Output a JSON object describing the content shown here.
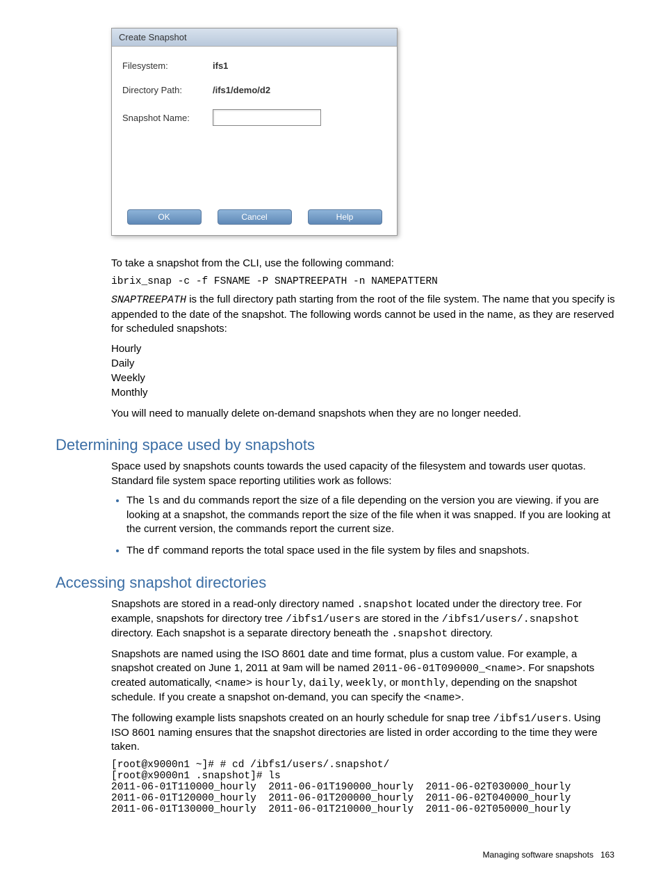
{
  "dialog": {
    "title": "Create Snapshot",
    "filesystem_label": "Filesystem:",
    "filesystem_value": "ifs1",
    "dirpath_label": "Directory Path:",
    "dirpath_value": "/ifs1/demo/d2",
    "snapname_label": "Snapshot Name:",
    "ok_label": "OK",
    "cancel_label": "Cancel",
    "help_label": "Help"
  },
  "body": {
    "cli_intro": "To take a snapshot from the CLI, use the following command:",
    "cli_cmd": "ibrix_snap -c -f FSNAME -P SNAPTREEPATH -n NAMEPATTERN",
    "snaptreepath_code": "SNAPTREEPATH",
    "snaptreepath_desc": " is the full directory path starting from the root of the file system. The name that you specify is appended to the date of the snapshot. The following words cannot be used in the name, as they are reserved for scheduled snapshots:",
    "reserved1": "Hourly",
    "reserved2": "Daily",
    "reserved3": "Weekly",
    "reserved4": "Monthly",
    "manual_delete": "You will need to manually delete on-demand snapshots when they are no longer needed."
  },
  "section1": {
    "heading": "Determining space used by snapshots",
    "para": "Space used by snapshots counts towards the used capacity of the filesystem and towards user quotas. Standard file system space reporting utilities work as follows:",
    "bullet1_a": "The ",
    "bullet1_ls": "ls",
    "bullet1_b": " and ",
    "bullet1_du": "du",
    "bullet1_c": " commands report the size of a file depending on the version you are viewing. if you are looking at a snapshot, the commands report the size of the file when it was snapped. If you are looking at the current version, the commands report the current size.",
    "bullet2_a": "The ",
    "bullet2_df": "df",
    "bullet2_b": " command reports the total space used in the file system by files and snapshots."
  },
  "section2": {
    "heading": "Accessing snapshot directories",
    "p1_a": "Snapshots are stored in a read-only directory named ",
    "p1_snap": ".snapshot",
    "p1_b": " located under the directory tree. For example, snapshots for directory tree ",
    "p1_path1": "/ibfs1/users",
    "p1_c": " are stored in the ",
    "p1_path2": "/ibfs1/users/.snapshot",
    "p1_d": " directory. Each snapshot is a separate directory beneath the ",
    "p1_snap2": ".snapshot",
    "p1_e": " directory.",
    "p2_a": "Snapshots are named using the ISO 8601 date and time format, plus a custom value. For example, a snapshot created on June 1, 2011 at 9am will be named ",
    "p2_name": "2011-06-01T090000_<name>",
    "p2_b": ". For snapshots created automatically, ",
    "p2_nametag": "<name>",
    "p2_c": " is ",
    "p2_hourly": "hourly",
    "p2_comma1": ", ",
    "p2_daily": "daily",
    "p2_comma2": ", ",
    "p2_weekly": "weekly",
    "p2_comma3": ", or ",
    "p2_monthly": "monthly",
    "p2_d": ", depending on the snapshot schedule. If you create a snapshot on-demand, you can specify the ",
    "p2_nametag2": "<name>",
    "p2_e": ".",
    "p3_a": "The following example lists snapshots created on an hourly schedule for snap tree ",
    "p3_path": "/ibfs1/users",
    "p3_b": ". Using ISO 8601 naming ensures that the snapshot directories are listed in order according to the time they were taken.",
    "code": "[root@x9000n1 ~]# # cd /ibfs1/users/.snapshot/\n[root@x9000n1 .snapshot]# ls\n2011-06-01T110000_hourly  2011-06-01T190000_hourly  2011-06-02T030000_hourly\n2011-06-01T120000_hourly  2011-06-01T200000_hourly  2011-06-02T040000_hourly\n2011-06-01T130000_hourly  2011-06-01T210000_hourly  2011-06-02T050000_hourly"
  },
  "footer": {
    "text": "Managing software snapshots",
    "page": "163"
  }
}
